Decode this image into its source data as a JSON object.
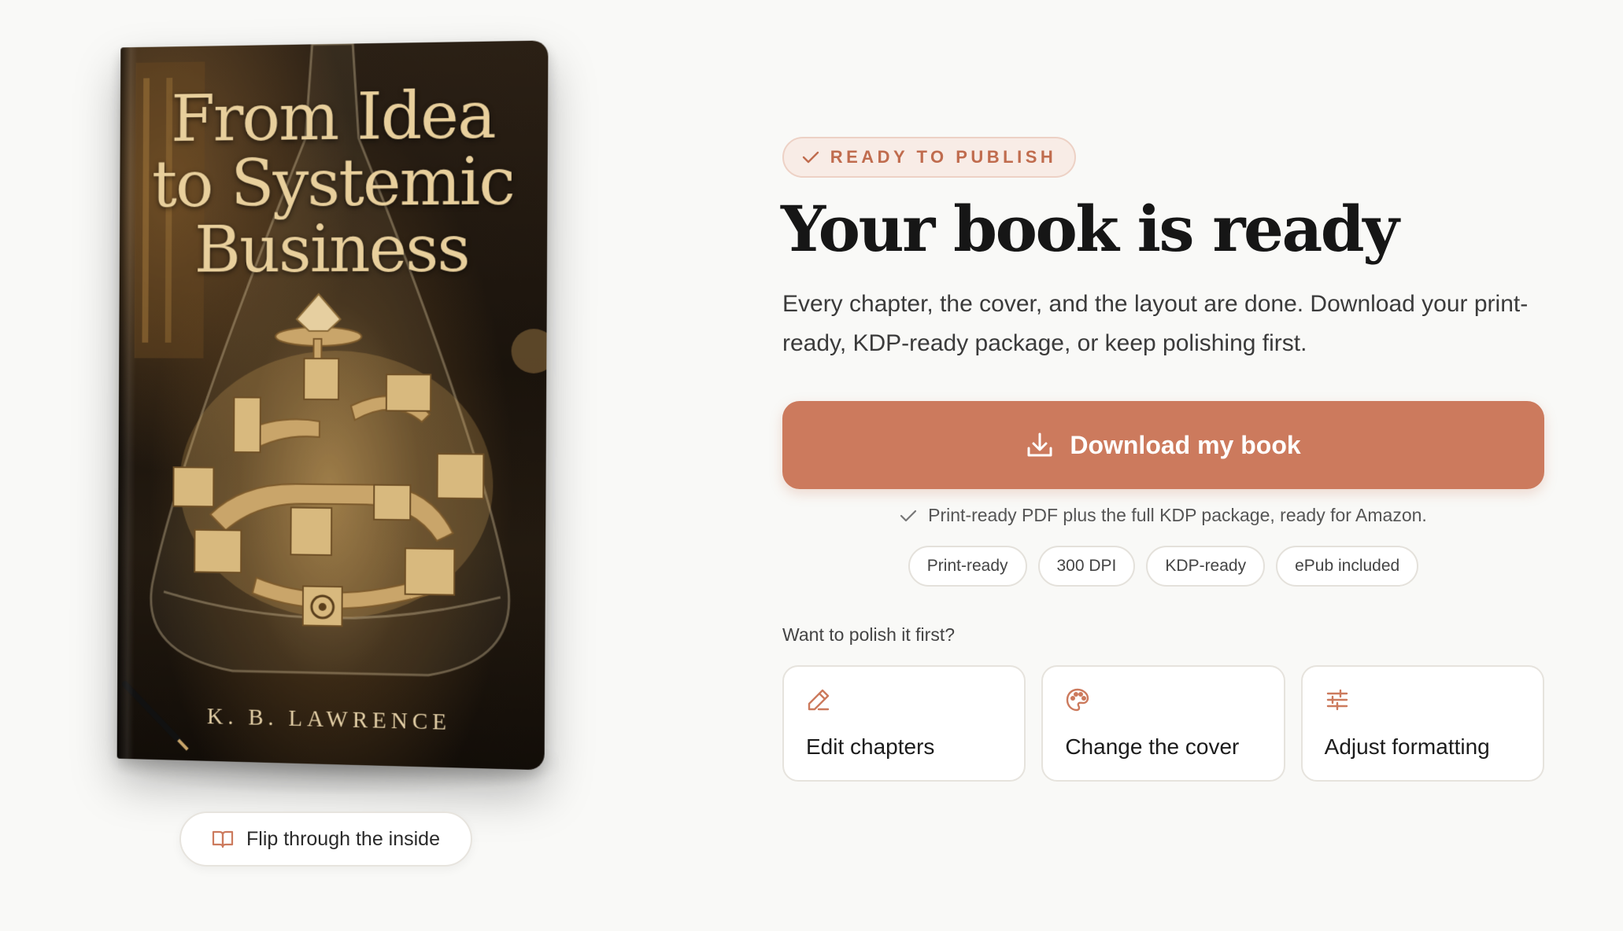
{
  "book": {
    "title_lines": [
      "From Idea",
      "to Systemic",
      "Business"
    ],
    "author": "K. B. LAWRENCE",
    "flip_button_label": "Flip through the inside"
  },
  "badge": {
    "label": "READY TO PUBLISH",
    "icon": "check-icon"
  },
  "headline": "Your book is ready",
  "lede": "Every chapter, the cover, and the layout are done. Download your print-ready, KDP-ready package, or keep polishing first.",
  "download": {
    "label": "Download my book",
    "icon": "download-icon"
  },
  "note": {
    "text": "Print-ready PDF plus the full KDP package, ready for Amazon.",
    "icon": "check-icon"
  },
  "chips": [
    "Print-ready",
    "300 DPI",
    "KDP-ready",
    "ePub included"
  ],
  "polish": {
    "label": "Want to polish it first?",
    "cards": [
      {
        "label": "Edit chapters",
        "icon": "pencil-icon"
      },
      {
        "label": "Change the cover",
        "icon": "palette-icon"
      },
      {
        "label": "Adjust formatting",
        "icon": "sliders-icon"
      }
    ]
  },
  "colors": {
    "accent": "#cc7a5d",
    "accent_text": "#c06c4e",
    "badge_bg": "#f8ece6",
    "page_bg": "#f9f9f7",
    "book_gold": "#e8cf9c"
  }
}
